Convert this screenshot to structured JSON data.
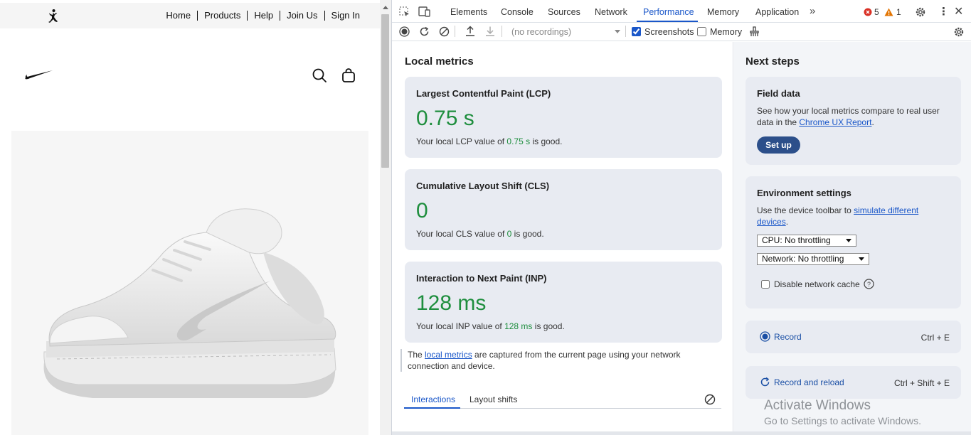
{
  "site": {
    "nav": [
      "Home",
      "Products",
      "Help",
      "Join Us",
      "Sign In"
    ]
  },
  "devtools": {
    "tabs": [
      "Elements",
      "Console",
      "Sources",
      "Network",
      "Performance",
      "Memory",
      "Application"
    ],
    "active_tab": "Performance",
    "error_count": "5",
    "warning_count": "1",
    "recordings_placeholder": "(no recordings)",
    "screenshots_label": "Screenshots",
    "screenshots_checked": true,
    "memory_label": "Memory",
    "memory_checked": false
  },
  "local_metrics": {
    "title": "Local metrics",
    "cards": [
      {
        "title": "Largest Contentful Paint (LCP)",
        "value": "0.75 s",
        "desc_pre": "Your local LCP value of ",
        "desc_val": "0.75 s",
        "desc_post": " is good."
      },
      {
        "title": "Cumulative Layout Shift (CLS)",
        "value": "0",
        "desc_pre": "Your local CLS value of ",
        "desc_val": "0",
        "desc_post": " is good."
      },
      {
        "title": "Interaction to Next Paint (INP)",
        "value": "128 ms",
        "desc_pre": "Your local INP value of ",
        "desc_val": "128 ms",
        "desc_post": " is good."
      }
    ],
    "note_pre": "The ",
    "note_link": "local metrics",
    "note_post": " are captured from the current page using your network connection and device.",
    "sub_tabs": [
      "Interactions",
      "Layout shifts"
    ]
  },
  "next_steps": {
    "title": "Next steps",
    "field_data": {
      "title": "Field data",
      "text_pre": "See how your local metrics compare to real user data in the ",
      "link": "Chrome UX Report",
      "text_post": ".",
      "button": "Set up"
    },
    "environment": {
      "title": "Environment settings",
      "text_pre": "Use the device toolbar to ",
      "link": "simulate different devices",
      "text_post": ".",
      "cpu": "CPU: No throttling",
      "network": "Network: No throttling",
      "disable_cache": "Disable network cache"
    },
    "record": {
      "label": "Record",
      "shortcut": "Ctrl + E"
    },
    "record_reload": {
      "label": "Record and reload",
      "shortcut": "Ctrl + Shift + E"
    }
  },
  "watermark": {
    "line1": "Activate Windows",
    "line2": "Go to Settings to activate Windows."
  },
  "colors": {
    "good": "#1e8e3e",
    "link": "#1a57c9",
    "accent_button": "#2c4f8a"
  }
}
